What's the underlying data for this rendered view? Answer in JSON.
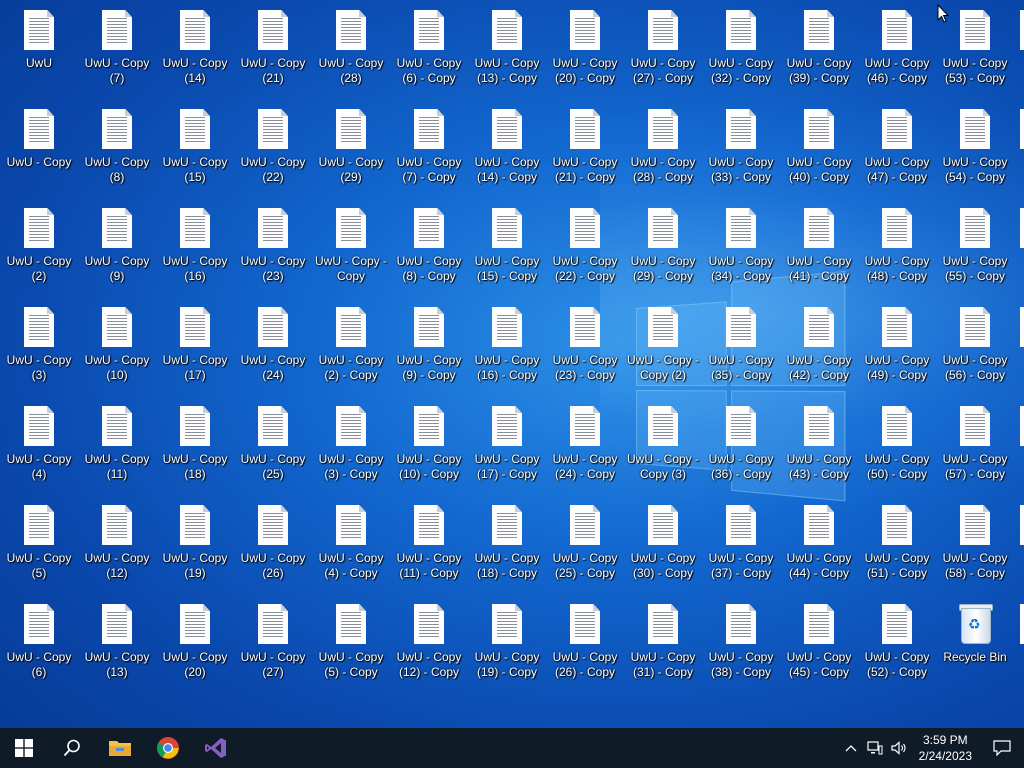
{
  "desktop": {
    "icons": [
      {
        "c": 0,
        "r": 0,
        "label": "UwU"
      },
      {
        "c": 1,
        "r": 0,
        "label": "UwU - Copy (7)"
      },
      {
        "c": 2,
        "r": 0,
        "label": "UwU - Copy (14)"
      },
      {
        "c": 3,
        "r": 0,
        "label": "UwU - Copy (21)"
      },
      {
        "c": 4,
        "r": 0,
        "label": "UwU - Copy (28)"
      },
      {
        "c": 5,
        "r": 0,
        "label": "UwU - Copy (6) - Copy"
      },
      {
        "c": 6,
        "r": 0,
        "label": "UwU - Copy (13) - Copy"
      },
      {
        "c": 7,
        "r": 0,
        "label": "UwU - Copy (20) - Copy"
      },
      {
        "c": 8,
        "r": 0,
        "label": "UwU - Copy (27) - Copy"
      },
      {
        "c": 9,
        "r": 0,
        "label": "UwU - Copy (32) - Copy"
      },
      {
        "c": 10,
        "r": 0,
        "label": "UwU - Copy (39) - Copy"
      },
      {
        "c": 11,
        "r": 0,
        "label": "UwU - Copy (46) - Copy"
      },
      {
        "c": 12,
        "r": 0,
        "label": "UwU - Copy (53) - Copy"
      },
      {
        "c": 0,
        "r": 1,
        "label": "UwU - Copy"
      },
      {
        "c": 1,
        "r": 1,
        "label": "UwU - Copy (8)"
      },
      {
        "c": 2,
        "r": 1,
        "label": "UwU - Copy (15)"
      },
      {
        "c": 3,
        "r": 1,
        "label": "UwU - Copy (22)"
      },
      {
        "c": 4,
        "r": 1,
        "label": "UwU - Copy (29)"
      },
      {
        "c": 5,
        "r": 1,
        "label": "UwU - Copy (7) - Copy"
      },
      {
        "c": 6,
        "r": 1,
        "label": "UwU - Copy (14) - Copy"
      },
      {
        "c": 7,
        "r": 1,
        "label": "UwU - Copy (21) - Copy"
      },
      {
        "c": 8,
        "r": 1,
        "label": "UwU - Copy (28) - Copy"
      },
      {
        "c": 9,
        "r": 1,
        "label": "UwU - Copy (33) - Copy"
      },
      {
        "c": 10,
        "r": 1,
        "label": "UwU - Copy (40) - Copy"
      },
      {
        "c": 11,
        "r": 1,
        "label": "UwU - Copy (47) - Copy"
      },
      {
        "c": 12,
        "r": 1,
        "label": "UwU - Copy (54) - Copy"
      },
      {
        "c": 0,
        "r": 2,
        "label": "UwU - Copy (2)"
      },
      {
        "c": 1,
        "r": 2,
        "label": "UwU - Copy (9)"
      },
      {
        "c": 2,
        "r": 2,
        "label": "UwU - Copy (16)"
      },
      {
        "c": 3,
        "r": 2,
        "label": "UwU - Copy (23)"
      },
      {
        "c": 4,
        "r": 2,
        "label": "UwU - Copy - Copy"
      },
      {
        "c": 5,
        "r": 2,
        "label": "UwU - Copy (8) - Copy"
      },
      {
        "c": 6,
        "r": 2,
        "label": "UwU - Copy (15) - Copy"
      },
      {
        "c": 7,
        "r": 2,
        "label": "UwU - Copy (22) - Copy"
      },
      {
        "c": 8,
        "r": 2,
        "label": "UwU - Copy (29) - Copy"
      },
      {
        "c": 9,
        "r": 2,
        "label": "UwU - Copy (34) - Copy"
      },
      {
        "c": 10,
        "r": 2,
        "label": "UwU - Copy (41) - Copy"
      },
      {
        "c": 11,
        "r": 2,
        "label": "UwU - Copy (48) - Copy"
      },
      {
        "c": 12,
        "r": 2,
        "label": "UwU - Copy (55) - Copy"
      },
      {
        "c": 0,
        "r": 3,
        "label": "UwU - Copy (3)"
      },
      {
        "c": 1,
        "r": 3,
        "label": "UwU - Copy (10)"
      },
      {
        "c": 2,
        "r": 3,
        "label": "UwU - Copy (17)"
      },
      {
        "c": 3,
        "r": 3,
        "label": "UwU - Copy (24)"
      },
      {
        "c": 4,
        "r": 3,
        "label": "UwU - Copy (2) - Copy"
      },
      {
        "c": 5,
        "r": 3,
        "label": "UwU - Copy (9) - Copy"
      },
      {
        "c": 6,
        "r": 3,
        "label": "UwU - Copy (16) - Copy"
      },
      {
        "c": 7,
        "r": 3,
        "label": "UwU - Copy (23) - Copy"
      },
      {
        "c": 8,
        "r": 3,
        "label": "UwU - Copy - Copy (2)"
      },
      {
        "c": 9,
        "r": 3,
        "label": "UwU - Copy (35) - Copy"
      },
      {
        "c": 10,
        "r": 3,
        "label": "UwU - Copy (42) - Copy"
      },
      {
        "c": 11,
        "r": 3,
        "label": "UwU - Copy (49) - Copy"
      },
      {
        "c": 12,
        "r": 3,
        "label": "UwU - Copy (56) - Copy"
      },
      {
        "c": 0,
        "r": 4,
        "label": "UwU - Copy (4)"
      },
      {
        "c": 1,
        "r": 4,
        "label": "UwU - Copy (11)"
      },
      {
        "c": 2,
        "r": 4,
        "label": "UwU - Copy (18)"
      },
      {
        "c": 3,
        "r": 4,
        "label": "UwU - Copy (25)"
      },
      {
        "c": 4,
        "r": 4,
        "label": "UwU - Copy (3) - Copy"
      },
      {
        "c": 5,
        "r": 4,
        "label": "UwU - Copy (10) - Copy"
      },
      {
        "c": 6,
        "r": 4,
        "label": "UwU - Copy (17) - Copy"
      },
      {
        "c": 7,
        "r": 4,
        "label": "UwU - Copy (24) - Copy"
      },
      {
        "c": 8,
        "r": 4,
        "label": "UwU - Copy - Copy (3)"
      },
      {
        "c": 9,
        "r": 4,
        "label": "UwU - Copy (36) - Copy"
      },
      {
        "c": 10,
        "r": 4,
        "label": "UwU - Copy (43) - Copy"
      },
      {
        "c": 11,
        "r": 4,
        "label": "UwU - Copy (50) - Copy"
      },
      {
        "c": 12,
        "r": 4,
        "label": "UwU - Copy (57) - Copy"
      },
      {
        "c": 0,
        "r": 5,
        "label": "UwU - Copy (5)"
      },
      {
        "c": 1,
        "r": 5,
        "label": "UwU - Copy (12)"
      },
      {
        "c": 2,
        "r": 5,
        "label": "UwU - Copy (19)"
      },
      {
        "c": 3,
        "r": 5,
        "label": "UwU - Copy (26)"
      },
      {
        "c": 4,
        "r": 5,
        "label": "UwU - Copy (4) - Copy"
      },
      {
        "c": 5,
        "r": 5,
        "label": "UwU - Copy (11) - Copy"
      },
      {
        "c": 6,
        "r": 5,
        "label": "UwU - Copy (18) - Copy"
      },
      {
        "c": 7,
        "r": 5,
        "label": "UwU - Copy (25) - Copy"
      },
      {
        "c": 8,
        "r": 5,
        "label": "UwU - Copy (30) - Copy"
      },
      {
        "c": 9,
        "r": 5,
        "label": "UwU - Copy (37) - Copy"
      },
      {
        "c": 10,
        "r": 5,
        "label": "UwU - Copy (44) - Copy"
      },
      {
        "c": 11,
        "r": 5,
        "label": "UwU - Copy (51) - Copy"
      },
      {
        "c": 12,
        "r": 5,
        "label": "UwU - Copy (58) - Copy"
      },
      {
        "c": 0,
        "r": 6,
        "label": "UwU - Copy (6)"
      },
      {
        "c": 1,
        "r": 6,
        "label": "UwU - Copy (13)"
      },
      {
        "c": 2,
        "r": 6,
        "label": "UwU - Copy (20)"
      },
      {
        "c": 3,
        "r": 6,
        "label": "UwU - Copy (27)"
      },
      {
        "c": 4,
        "r": 6,
        "label": "UwU - Copy (5) - Copy"
      },
      {
        "c": 5,
        "r": 6,
        "label": "UwU - Copy (12) - Copy"
      },
      {
        "c": 6,
        "r": 6,
        "label": "UwU - Copy (19) - Copy"
      },
      {
        "c": 7,
        "r": 6,
        "label": "UwU - Copy (26) - Copy"
      },
      {
        "c": 8,
        "r": 6,
        "label": "UwU - Copy (31) - Copy"
      },
      {
        "c": 9,
        "r": 6,
        "label": "UwU - Copy (38) - Copy"
      },
      {
        "c": 10,
        "r": 6,
        "label": "UwU - Copy (45) - Copy"
      },
      {
        "c": 11,
        "r": 6,
        "label": "UwU - Copy (52) - Copy"
      },
      {
        "c": 12,
        "r": 6,
        "label": "Recycle Bin",
        "type": "recycle-bin"
      }
    ]
  },
  "taskbar": {
    "start_icon": "windows-start-icon",
    "search_icon": "search-icon",
    "pinned": [
      "file-explorer-icon",
      "chrome-icon",
      "visual-studio-icon"
    ],
    "tray": {
      "icons": [
        "chevron-up-icon",
        "network-icon",
        "volume-icon"
      ],
      "time": "3:59 PM",
      "date": "2/24/2023",
      "notification_icon": "notification-icon"
    },
    "colors": {
      "background": "#101b28",
      "chrome_red": "#db4437",
      "vs_purple": "#865fc5",
      "folder_yellow": "#f5c342"
    }
  }
}
